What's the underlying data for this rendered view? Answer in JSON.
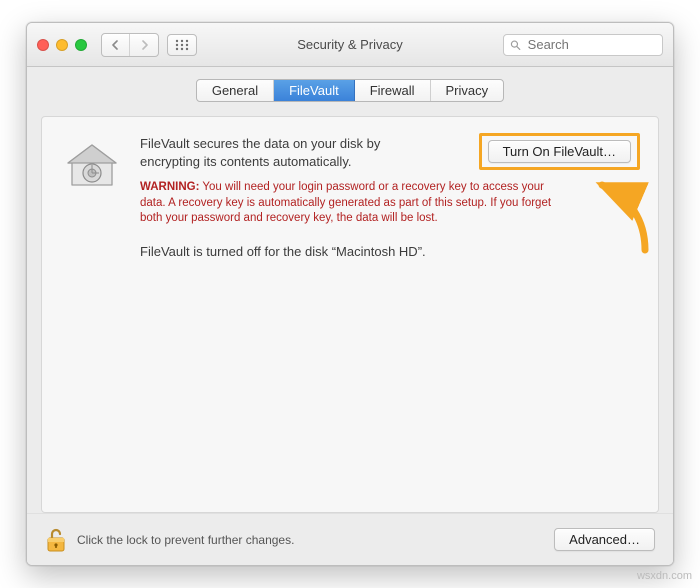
{
  "window": {
    "title": "Security & Privacy"
  },
  "search": {
    "placeholder": "Search"
  },
  "tabs": {
    "general": "General",
    "filevault": "FileVault",
    "firewall": "Firewall",
    "privacy": "Privacy"
  },
  "main": {
    "description": "FileVault secures the data on your disk by encrypting its contents automatically.",
    "warning_label": "WARNING:",
    "warning_text": " You will need your login password or a recovery key to access your data. A recovery key is automatically generated as part of this setup. If you forget both your password and recovery key, the data will be lost.",
    "status": "FileVault is turned off for the disk “Macintosh HD”.",
    "turn_on_label": "Turn On FileVault…"
  },
  "footer": {
    "lock_hint": "Click the lock to prevent further changes.",
    "advanced_label": "Advanced…"
  },
  "watermark": "wsxdn.com"
}
